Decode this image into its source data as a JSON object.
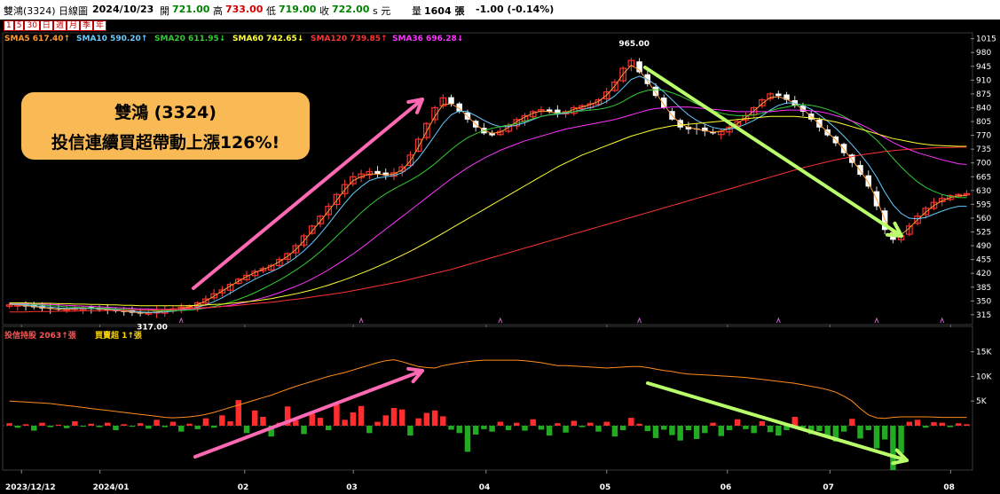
{
  "header": {
    "stock": "雙鴻(3324)",
    "type": "日線圖",
    "date": "2024/10/23",
    "open_label": "開",
    "open": "721.00",
    "high_label": "高",
    "high": "733.00",
    "low_label": "低",
    "low": "719.00",
    "close_label": "收",
    "close": "722.00",
    "unit": "s 元",
    "vol_label": "量",
    "vol": "1604 張",
    "change": "-1.00 (-0.14%)"
  },
  "periods": [
    "1",
    "5",
    "30",
    "日",
    "週",
    "月",
    "季",
    "年"
  ],
  "sma_legend": [
    {
      "text": "SMA5 617.40↑",
      "color": "#ff9933"
    },
    {
      "text": "SMA10 590.20↑",
      "color": "#66ccff"
    },
    {
      "text": "SMA20 611.95↓",
      "color": "#33cc33"
    },
    {
      "text": "SMA60 742.65↓",
      "color": "#ffff33"
    },
    {
      "text": "SMA120 739.85↑",
      "color": "#ff3333"
    },
    {
      "text": "SMA36 696.28↓",
      "color": "#ff33ff"
    }
  ],
  "annotation": {
    "line1": "雙鴻 (3324)",
    "line2": "投信連續買超帶動上漲126%!"
  },
  "sub_legend": {
    "left": "投信持股 2063↑張",
    "right": "買賣超 1↑張"
  },
  "chart_data": [
    {
      "type": "candlestick",
      "price_ticks": [
        1015,
        980,
        945,
        910,
        875,
        840,
        805,
        770,
        735,
        700,
        665,
        630,
        595,
        560,
        525,
        490,
        455,
        420,
        385,
        350,
        315
      ],
      "ylim": [
        290,
        1030
      ],
      "annotations": [
        {
          "text": "965.00",
          "at": "high"
        },
        {
          "text": "317.00",
          "at": "low"
        }
      ],
      "x_labels": [
        "2023/12/12",
        "2024/01",
        "02",
        "03",
        "04",
        "05",
        "06",
        "07",
        "08"
      ],
      "close_path": [
        340,
        340,
        336,
        334,
        331,
        330,
        328,
        329,
        331,
        333,
        330,
        328,
        326,
        324,
        322,
        320,
        318,
        320,
        325,
        328,
        330,
        334,
        338,
        345,
        355,
        368,
        378,
        392,
        405,
        415,
        425,
        432,
        440,
        455,
        470,
        490,
        515,
        540,
        565,
        590,
        620,
        645,
        665,
        672,
        678,
        672,
        668,
        675,
        690,
        720,
        760,
        800,
        840,
        865,
        850,
        830,
        810,
        790,
        775,
        770,
        780,
        795,
        810,
        820,
        830,
        835,
        830,
        825,
        830,
        840,
        845,
        850,
        860,
        880,
        905,
        940,
        960,
        930,
        900,
        870,
        840,
        810,
        790,
        785,
        785,
        780,
        775,
        780,
        790,
        805,
        820,
        840,
        860,
        875,
        870,
        860,
        845,
        830,
        810,
        790,
        770,
        750,
        725,
        700,
        670,
        640,
        590,
        530,
        505,
        515,
        540,
        565,
        585,
        600,
        610,
        617,
        620,
        622
      ],
      "series": [
        {
          "name": "SMA5",
          "color": "#ff9933",
          "values": [
            341,
            340,
            338,
            336,
            333,
            331,
            329,
            329,
            330,
            331,
            331,
            330,
            328,
            326,
            324,
            322,
            320,
            320,
            322,
            325,
            328,
            331,
            335,
            341,
            350,
            362,
            375,
            388,
            400,
            412,
            422,
            430,
            438,
            450,
            463,
            480,
            502,
            527,
            552,
            578,
            605,
            632,
            655,
            665,
            672,
            672,
            670,
            672,
            682,
            705,
            740,
            780,
            818,
            848,
            850,
            838,
            818,
            798,
            782,
            775,
            778,
            790,
            805,
            816,
            826,
            832,
            830,
            826,
            828,
            836,
            842,
            848,
            856,
            872,
            895,
            925,
            948,
            935,
            908,
            878,
            848,
            820,
            800,
            790,
            786,
            782,
            778,
            780,
            788,
            800,
            815,
            832,
            850,
            866,
            868,
            862,
            850,
            836,
            818,
            798,
            778,
            758,
            734,
            708,
            680,
            650,
            608,
            556,
            520,
            518,
            535,
            556,
            575,
            592,
            604,
            612,
            617,
            617
          ]
        },
        {
          "name": "SMA10",
          "color": "#66ccff",
          "values": [
            342,
            341,
            340,
            338,
            336,
            334,
            332,
            331,
            331,
            331,
            331,
            331,
            330,
            328,
            326,
            324,
            322,
            321,
            321,
            322,
            324,
            327,
            330,
            334,
            340,
            348,
            358,
            370,
            382,
            394,
            405,
            415,
            424,
            434,
            446,
            460,
            477,
            497,
            520,
            545,
            572,
            598,
            622,
            640,
            655,
            662,
            665,
            668,
            675,
            690,
            712,
            740,
            770,
            800,
            822,
            832,
            830,
            820,
            808,
            798,
            792,
            792,
            796,
            802,
            810,
            818,
            822,
            824,
            826,
            830,
            835,
            840,
            846,
            856,
            870,
            890,
            912,
            920,
            912,
            898,
            880,
            860,
            840,
            822,
            808,
            798,
            790,
            786,
            786,
            790,
            798,
            808,
            820,
            834,
            846,
            852,
            852,
            846,
            836,
            822,
            806,
            788,
            768,
            746,
            722,
            696,
            664,
            626,
            594,
            572,
            560,
            558,
            562,
            570,
            578,
            585,
            590,
            590
          ]
        },
        {
          "name": "SMA20",
          "color": "#33cc33",
          "values": [
            343,
            343,
            342,
            341,
            340,
            338,
            337,
            335,
            334,
            333,
            332,
            332,
            331,
            330,
            329,
            328,
            327,
            326,
            325,
            325,
            325,
            326,
            327,
            329,
            332,
            336,
            341,
            347,
            354,
            362,
            371,
            381,
            392,
            403,
            415,
            428,
            442,
            458,
            475,
            494,
            514,
            534,
            554,
            574,
            592,
            608,
            622,
            634,
            645,
            656,
            668,
            682,
            698,
            716,
            734,
            750,
            764,
            774,
            782,
            788,
            792,
            796,
            800,
            806,
            812,
            818,
            822,
            826,
            828,
            830,
            832,
            834,
            836,
            840,
            846,
            856,
            868,
            878,
            884,
            886,
            884,
            878,
            870,
            860,
            850,
            840,
            832,
            826,
            822,
            820,
            820,
            822,
            826,
            832,
            838,
            842,
            846,
            848,
            846,
            842,
            836,
            828,
            818,
            806,
            792,
            776,
            758,
            736,
            712,
            690,
            670,
            652,
            638,
            628,
            620,
            615,
            612,
            612
          ]
        },
        {
          "name": "SMA36",
          "color": "#ff33ff",
          "values": [
            344,
            344,
            343,
            343,
            342,
            341,
            340,
            339,
            338,
            337,
            336,
            335,
            334,
            333,
            332,
            331,
            330,
            330,
            329,
            329,
            329,
            329,
            330,
            331,
            332,
            334,
            336,
            339,
            343,
            347,
            352,
            358,
            364,
            371,
            379,
            387,
            396,
            406,
            417,
            429,
            442,
            455,
            469,
            484,
            500,
            516,
            532,
            548,
            564,
            580,
            596,
            612,
            628,
            644,
            660,
            674,
            688,
            700,
            712,
            722,
            732,
            740,
            748,
            756,
            762,
            768,
            774,
            780,
            786,
            790,
            794,
            798,
            802,
            806,
            810,
            816,
            822,
            828,
            834,
            838,
            840,
            842,
            842,
            842,
            840,
            838,
            836,
            834,
            832,
            830,
            830,
            830,
            830,
            830,
            832,
            834,
            834,
            834,
            832,
            830,
            826,
            820,
            814,
            806,
            798,
            788,
            776,
            764,
            752,
            742,
            734,
            726,
            720,
            714,
            708,
            703,
            698,
            696
          ]
        },
        {
          "name": "SMA60",
          "color": "#ffff33",
          "values": [
            345,
            345,
            345,
            344,
            344,
            344,
            343,
            343,
            342,
            342,
            341,
            341,
            340,
            340,
            339,
            339,
            338,
            338,
            338,
            338,
            338,
            338,
            338,
            339,
            340,
            341,
            342,
            344,
            346,
            348,
            350,
            353,
            356,
            360,
            364,
            368,
            373,
            378,
            384,
            390,
            397,
            404,
            412,
            420,
            428,
            437,
            446,
            456,
            466,
            476,
            487,
            498,
            510,
            522,
            534,
            546,
            558,
            570,
            582,
            594,
            606,
            618,
            630,
            642,
            654,
            666,
            678,
            690,
            700,
            710,
            720,
            728,
            736,
            744,
            752,
            760,
            768,
            774,
            780,
            786,
            790,
            794,
            796,
            798,
            800,
            802,
            804,
            806,
            808,
            810,
            812,
            814,
            816,
            818,
            818,
            818,
            818,
            816,
            814,
            812,
            808,
            804,
            798,
            792,
            786,
            780,
            774,
            768,
            762,
            758,
            754,
            750,
            747,
            745,
            744,
            743,
            742,
            742
          ]
        },
        {
          "name": "SMA120",
          "color": "#ff3333",
          "values": [
            322,
            322,
            322,
            323,
            323,
            323,
            324,
            324,
            324,
            325,
            325,
            325,
            326,
            326,
            326,
            327,
            327,
            327,
            328,
            328,
            329,
            330,
            331,
            332,
            333,
            334,
            336,
            337,
            339,
            341,
            343,
            345,
            347,
            349,
            352,
            354,
            357,
            360,
            363,
            366,
            369,
            372,
            376,
            380,
            384,
            388,
            392,
            396,
            400,
            405,
            410,
            415,
            420,
            425,
            430,
            436,
            442,
            448,
            454,
            460,
            466,
            472,
            478,
            484,
            490,
            496,
            502,
            508,
            514,
            520,
            526,
            532,
            538,
            544,
            550,
            556,
            562,
            568,
            574,
            580,
            586,
            592,
            598,
            604,
            610,
            616,
            622,
            628,
            634,
            640,
            646,
            652,
            658,
            664,
            670,
            676,
            682,
            688,
            693,
            698,
            703,
            708,
            712,
            716,
            720,
            723,
            726,
            729,
            731,
            733,
            735,
            736,
            737,
            738,
            739,
            739,
            740,
            740
          ]
        }
      ]
    },
    {
      "type": "bar+line",
      "y_ticks": [
        "15K",
        "10K",
        "5K"
      ],
      "ylim": [
        -9000,
        18000
      ],
      "net_buy": [
        500,
        -400,
        300,
        -1000,
        600,
        -300,
        200,
        -500,
        900,
        -200,
        400,
        -300,
        600,
        -900,
        300,
        -200,
        500,
        -600,
        1200,
        -300,
        800,
        -1200,
        400,
        -700,
        1500,
        -400,
        2100,
        900,
        5200,
        -1500,
        3100,
        1800,
        -2200,
        600,
        3900,
        1100,
        -1700,
        2400,
        1600,
        -900,
        4300,
        1200,
        2700,
        4000,
        -1500,
        800,
        2100,
        3600,
        3300,
        -2000,
        1500,
        2600,
        3100,
        1900,
        -800,
        -1500,
        -5300,
        -1800,
        -700,
        -1200,
        800,
        -900,
        600,
        -1000,
        1300,
        -800,
        -2000,
        500,
        -1400,
        1000,
        -300,
        600,
        -1200,
        800,
        -2200,
        -900,
        1600,
        400,
        -1100,
        -2500,
        -800,
        -1900,
        -3000,
        -900,
        -2700,
        -1500,
        600,
        -2100,
        -900,
        1300,
        -700,
        -1500,
        900,
        -1300,
        -2000,
        -900,
        1800,
        -400,
        -1700,
        -1100,
        -2300,
        -3200,
        -1200,
        1400,
        -2600,
        -900,
        -4600,
        -2800,
        -9000,
        -5600,
        800,
        1200,
        -400,
        700,
        600,
        -300,
        500,
        300
      ],
      "holding_path": [
        5000,
        4900,
        4800,
        4700,
        4600,
        4500,
        4300,
        4100,
        3900,
        3700,
        3500,
        3300,
        3100,
        2900,
        2700,
        2500,
        2300,
        2100,
        1900,
        1700,
        1600,
        1700,
        1800,
        2000,
        2300,
        2700,
        3200,
        3700,
        4200,
        4700,
        5200,
        5700,
        6200,
        6800,
        7400,
        8000,
        8500,
        9000,
        9500,
        10000,
        10400,
        10800,
        11300,
        11800,
        12300,
        12800,
        13200,
        13400,
        13000,
        12500,
        12000,
        11800,
        11700,
        12200,
        12500,
        12800,
        13000,
        13200,
        13300,
        13300,
        13300,
        13300,
        13300,
        13200,
        13000,
        12800,
        12500,
        12200,
        12200,
        12100,
        12000,
        11900,
        11800,
        11700,
        11800,
        11900,
        12000,
        12000,
        11800,
        11500,
        11200,
        11000,
        10700,
        10500,
        10400,
        10300,
        10200,
        10100,
        10000,
        9900,
        9800,
        9600,
        9400,
        9200,
        9000,
        8800,
        8600,
        8300,
        8000,
        7700,
        7300,
        6800,
        6000,
        5000,
        3500,
        2200,
        1600,
        1500,
        1700,
        1800,
        1800,
        1800,
        1800,
        1750,
        1700,
        1700,
        1700,
        1700
      ]
    }
  ]
}
